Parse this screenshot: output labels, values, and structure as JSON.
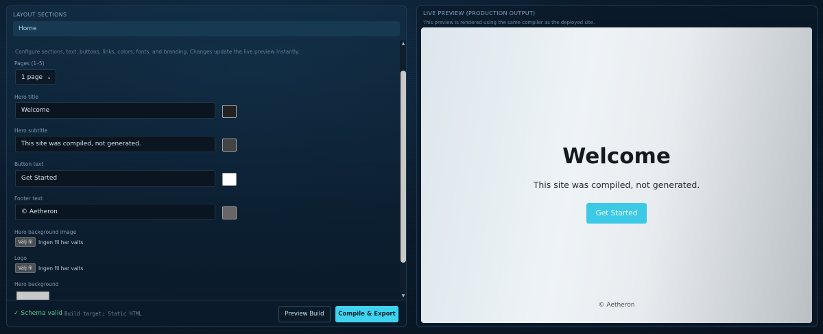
{
  "left": {
    "section_title": "LAYOUT SECTIONS",
    "active_tab": "Home",
    "hint": "Configure sections, text, buttons, links, colors, fonts, and branding. Changes update the live preview instantly.",
    "pages_label": "Pages (1–5)",
    "pages_value": "1 page",
    "fields": {
      "hero_title": {
        "label": "Hero title",
        "value": "Welcome",
        "color": "#222222"
      },
      "hero_subtitle": {
        "label": "Hero subtitle",
        "value": "This site was compiled, not generated.",
        "color": "#444444"
      },
      "button_text": {
        "label": "Button text",
        "value": "Get Started",
        "color": "#ffffff"
      },
      "footer_text": {
        "label": "Footer text",
        "value": "© Aetheron",
        "color": "#666666"
      }
    },
    "hero_bg_image": {
      "label": "Hero background image",
      "button": "Välj fil",
      "status": "Ingen fil har valts"
    },
    "logo": {
      "label": "Logo",
      "button": "Välj fil",
      "status": "Ingen fil har valts"
    },
    "hero_background": {
      "label": "Hero background",
      "color": "#c9c9c9"
    },
    "footer": {
      "schema": "✓ Schema valid",
      "build_target": "Build target: Static HTML",
      "preview_button": "Preview Build",
      "compile_button": "Compile & Export"
    }
  },
  "right": {
    "section_title": "LIVE PREVIEW (PRODUCTION OUTPUT)",
    "subtitle": "This preview is rendered using the same compiler as the deployed site.",
    "preview": {
      "title": "Welcome",
      "subtitle": "This site was compiled, not generated.",
      "button": "Get Started",
      "footer": "© Aetheron"
    }
  }
}
